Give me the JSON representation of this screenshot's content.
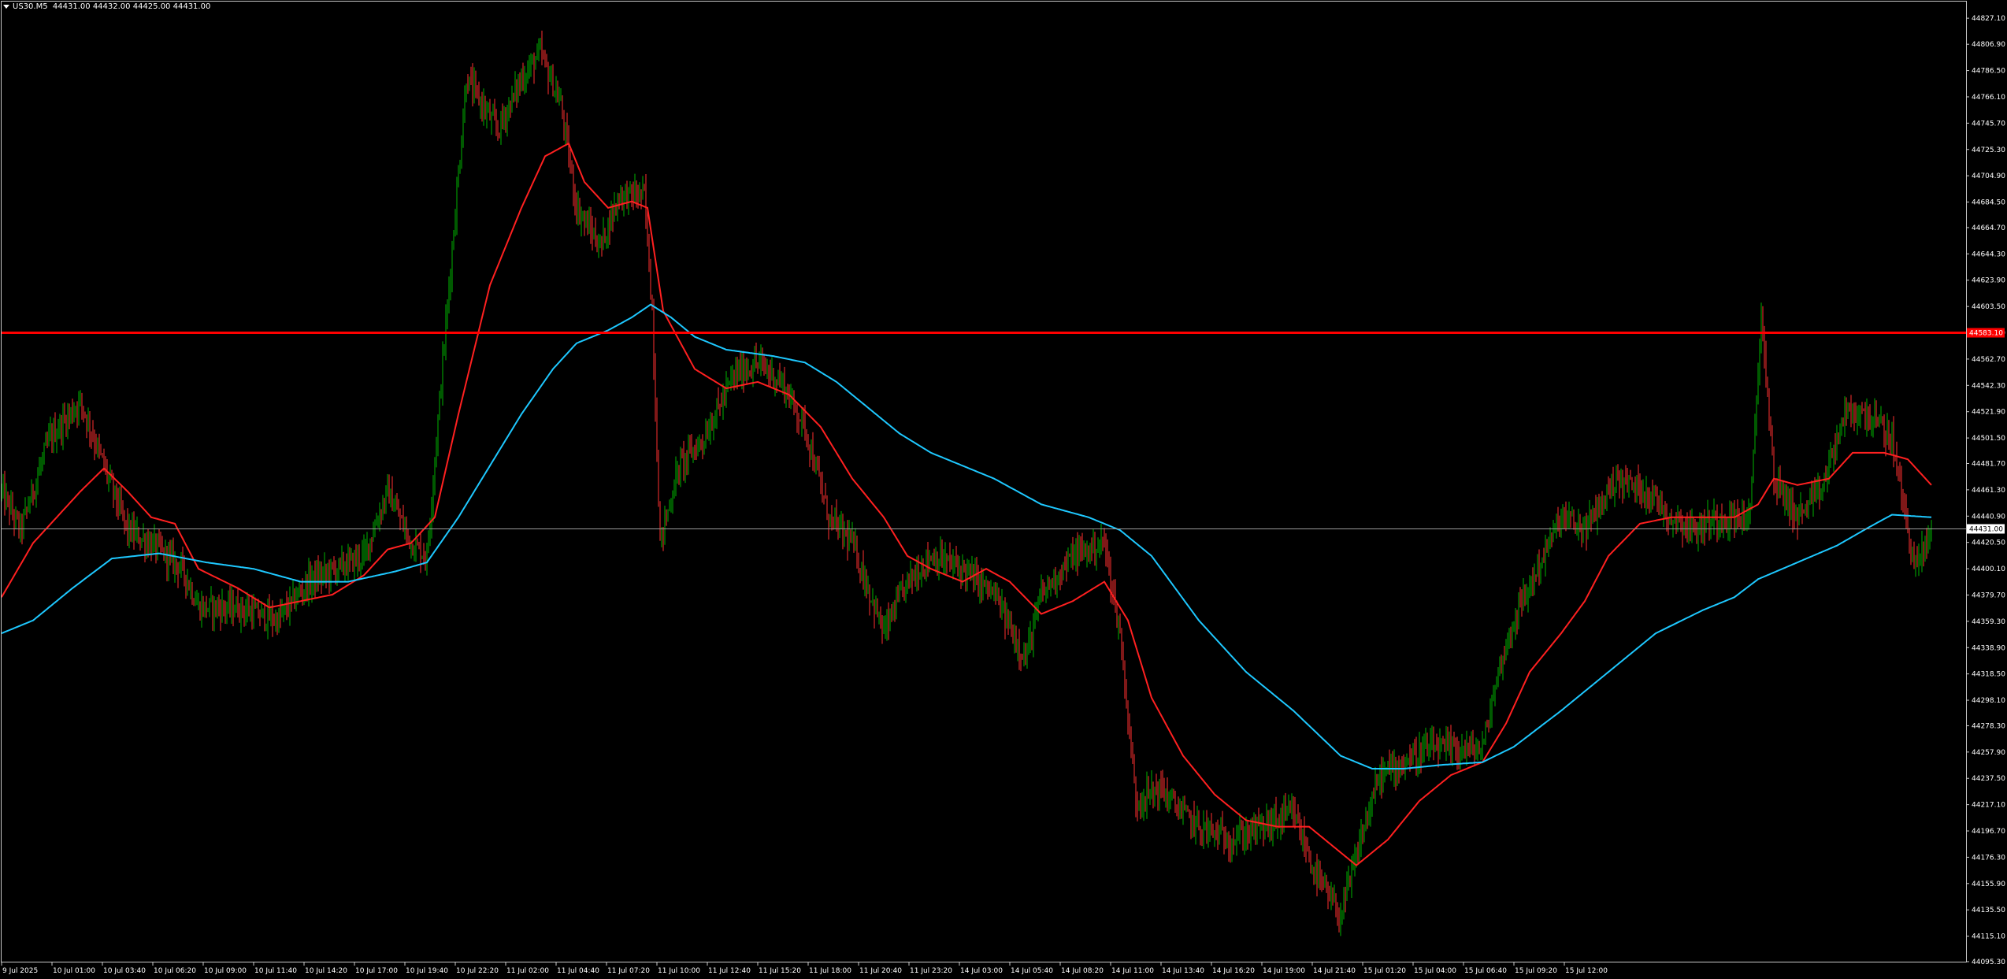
{
  "header": {
    "symbol": "US30.M5",
    "ohlc": "44431.00 44432.00 44425.00 44431.00"
  },
  "colors": {
    "background": "#000000",
    "frame": "#c8c8c8",
    "bull": "#00b400",
    "bear": "#ff3030",
    "ma_fast": "#ff2020",
    "ma_slow": "#1ec8ff",
    "hline": "#ff0000",
    "bidline": "#b4b4b4",
    "text": "#ffffff"
  },
  "price_axis": {
    "min": 44095.3,
    "max": 44840.0,
    "labels": [
      "44827.10",
      "44806.90",
      "44786.50",
      "44766.10",
      "44745.70",
      "44725.30",
      "44704.90",
      "44684.50",
      "44664.70",
      "44644.30",
      "44623.90",
      "44603.50",
      "44583.10",
      "44562.70",
      "44542.30",
      "44521.90",
      "44501.50",
      "44481.70",
      "44461.30",
      "44440.90",
      "44420.50",
      "44400.10",
      "44379.70",
      "44359.30",
      "44338.90",
      "44318.50",
      "44298.10",
      "44278.30",
      "44257.90",
      "44237.50",
      "44217.10",
      "44196.70",
      "44176.30",
      "44155.90",
      "44135.50",
      "44115.10",
      "44095.30"
    ],
    "hline_price": 44583.1,
    "hline_label": "44583.10",
    "bid_price": 44431.0,
    "bid_label": "44431.00"
  },
  "time_axis": {
    "labels": [
      "9 Jul 2025",
      "10 Jul 01:00",
      "10 Jul 03:40",
      "10 Jul 06:20",
      "10 Jul 09:00",
      "10 Jul 11:40",
      "10 Jul 14:20",
      "10 Jul 17:00",
      "10 Jul 19:40",
      "10 Jul 22:20",
      "11 Jul 02:00",
      "11 Jul 04:40",
      "11 Jul 07:20",
      "11 Jul 10:00",
      "11 Jul 12:40",
      "11 Jul 15:20",
      "11 Jul 18:00",
      "11 Jul 20:40",
      "11 Jul 23:20",
      "14 Jul 03:00",
      "14 Jul 05:40",
      "14 Jul 08:20",
      "14 Jul 11:00",
      "14 Jul 13:40",
      "14 Jul 16:20",
      "14 Jul 19:00",
      "14 Jul 21:40",
      "15 Jul 01:20",
      "15 Jul 04:00",
      "15 Jul 06:40",
      "15 Jul 09:20",
      "15 Jul 12:00"
    ]
  },
  "chart_data": {
    "type": "candlestick",
    "series": [
      {
        "name": "US30.M5",
        "role": "price",
        "keypoints": [
          [
            0,
            44460
          ],
          [
            12,
            44430
          ],
          [
            30,
            44500
          ],
          [
            50,
            44530
          ],
          [
            65,
            44480
          ],
          [
            80,
            44430
          ],
          [
            100,
            44415
          ],
          [
            115,
            44400
          ],
          [
            125,
            44370
          ],
          [
            150,
            44370
          ],
          [
            175,
            44360
          ],
          [
            195,
            44390
          ],
          [
            230,
            44410
          ],
          [
            245,
            44460
          ],
          [
            260,
            44420
          ],
          [
            270,
            44410
          ],
          [
            280,
            44560
          ],
          [
            295,
            44780
          ],
          [
            315,
            44740
          ],
          [
            330,
            44780
          ],
          [
            342,
            44800
          ],
          [
            355,
            44760
          ],
          [
            365,
            44680
          ],
          [
            380,
            44650
          ],
          [
            392,
            44690
          ],
          [
            408,
            44690
          ],
          [
            413,
            44600
          ],
          [
            418,
            44420
          ],
          [
            430,
            44480
          ],
          [
            445,
            44500
          ],
          [
            465,
            44550
          ],
          [
            480,
            44560
          ],
          [
            495,
            44545
          ],
          [
            510,
            44510
          ],
          [
            525,
            44440
          ],
          [
            540,
            44420
          ],
          [
            560,
            44350
          ],
          [
            575,
            44390
          ],
          [
            590,
            44410
          ],
          [
            610,
            44400
          ],
          [
            630,
            44380
          ],
          [
            650,
            44330
          ],
          [
            660,
            44380
          ],
          [
            680,
            44410
          ],
          [
            700,
            44420
          ],
          [
            710,
            44350
          ],
          [
            720,
            44220
          ],
          [
            735,
            44230
          ],
          [
            750,
            44210
          ],
          [
            760,
            44200
          ],
          [
            780,
            44190
          ],
          [
            800,
            44200
          ],
          [
            820,
            44210
          ],
          [
            835,
            44160
          ],
          [
            850,
            44130
          ],
          [
            865,
            44200
          ],
          [
            875,
            44240
          ],
          [
            890,
            44250
          ],
          [
            905,
            44260
          ],
          [
            920,
            44260
          ],
          [
            940,
            44260
          ],
          [
            950,
            44320
          ],
          [
            960,
            44360
          ],
          [
            975,
            44400
          ],
          [
            990,
            44440
          ],
          [
            1005,
            44430
          ],
          [
            1025,
            44470
          ],
          [
            1045,
            44460
          ],
          [
            1060,
            44440
          ],
          [
            1075,
            44430
          ],
          [
            1090,
            44440
          ],
          [
            1110,
            44440
          ],
          [
            1117,
            44600
          ],
          [
            1125,
            44470
          ],
          [
            1140,
            44440
          ],
          [
            1155,
            44460
          ],
          [
            1170,
            44520
          ],
          [
            1185,
            44520
          ],
          [
            1200,
            44500
          ],
          [
            1210,
            44430
          ],
          [
            1215,
            44400
          ],
          [
            1225,
            44430
          ]
        ]
      },
      {
        "name": "MA fast",
        "role": "ma",
        "keypoints": [
          [
            0,
            44378
          ],
          [
            20,
            44420
          ],
          [
            50,
            44460
          ],
          [
            65,
            44478
          ],
          [
            80,
            44460
          ],
          [
            95,
            44440
          ],
          [
            110,
            44435
          ],
          [
            125,
            44400
          ],
          [
            150,
            44385
          ],
          [
            170,
            44370
          ],
          [
            190,
            44375
          ],
          [
            210,
            44380
          ],
          [
            230,
            44395
          ],
          [
            245,
            44415
          ],
          [
            260,
            44420
          ],
          [
            275,
            44440
          ],
          [
            290,
            44520
          ],
          [
            310,
            44620
          ],
          [
            330,
            44680
          ],
          [
            345,
            44720
          ],
          [
            360,
            44730
          ],
          [
            370,
            44700
          ],
          [
            385,
            44680
          ],
          [
            400,
            44685
          ],
          [
            410,
            44680
          ],
          [
            420,
            44600
          ],
          [
            440,
            44555
          ],
          [
            460,
            44540
          ],
          [
            480,
            44545
          ],
          [
            500,
            44535
          ],
          [
            520,
            44510
          ],
          [
            540,
            44470
          ],
          [
            560,
            44440
          ],
          [
            575,
            44410
          ],
          [
            590,
            44400
          ],
          [
            610,
            44390
          ],
          [
            625,
            44400
          ],
          [
            640,
            44390
          ],
          [
            660,
            44365
          ],
          [
            680,
            44375
          ],
          [
            700,
            44390
          ],
          [
            715,
            44360
          ],
          [
            730,
            44300
          ],
          [
            750,
            44255
          ],
          [
            770,
            44225
          ],
          [
            790,
            44205
          ],
          [
            810,
            44200
          ],
          [
            830,
            44200
          ],
          [
            845,
            44185
          ],
          [
            860,
            44170
          ],
          [
            880,
            44190
          ],
          [
            900,
            44220
          ],
          [
            920,
            44240
          ],
          [
            940,
            44250
          ],
          [
            955,
            44280
          ],
          [
            970,
            44320
          ],
          [
            990,
            44350
          ],
          [
            1005,
            44375
          ],
          [
            1020,
            44410
          ],
          [
            1040,
            44435
          ],
          [
            1060,
            44440
          ],
          [
            1080,
            44440
          ],
          [
            1100,
            44440
          ],
          [
            1115,
            44450
          ],
          [
            1125,
            44470
          ],
          [
            1140,
            44465
          ],
          [
            1160,
            44470
          ],
          [
            1175,
            44490
          ],
          [
            1195,
            44490
          ],
          [
            1210,
            44485
          ],
          [
            1225,
            44465
          ]
        ]
      },
      {
        "name": "MA slow",
        "role": "ma",
        "keypoints": [
          [
            0,
            44350
          ],
          [
            20,
            44360
          ],
          [
            45,
            44385
          ],
          [
            70,
            44408
          ],
          [
            100,
            44412
          ],
          [
            130,
            44405
          ],
          [
            160,
            44400
          ],
          [
            190,
            44390
          ],
          [
            220,
            44390
          ],
          [
            250,
            44398
          ],
          [
            270,
            44405
          ],
          [
            290,
            44440
          ],
          [
            310,
            44480
          ],
          [
            330,
            44520
          ],
          [
            350,
            44555
          ],
          [
            365,
            44575
          ],
          [
            385,
            44585
          ],
          [
            400,
            44595
          ],
          [
            412,
            44605
          ],
          [
            425,
            44595
          ],
          [
            440,
            44580
          ],
          [
            460,
            44570
          ],
          [
            490,
            44565
          ],
          [
            510,
            44560
          ],
          [
            530,
            44545
          ],
          [
            550,
            44525
          ],
          [
            570,
            44505
          ],
          [
            590,
            44490
          ],
          [
            610,
            44480
          ],
          [
            630,
            44470
          ],
          [
            660,
            44450
          ],
          [
            690,
            44440
          ],
          [
            710,
            44430
          ],
          [
            730,
            44410
          ],
          [
            760,
            44360
          ],
          [
            790,
            44320
          ],
          [
            820,
            44290
          ],
          [
            850,
            44255
          ],
          [
            870,
            44245
          ],
          [
            890,
            44245
          ],
          [
            915,
            44248
          ],
          [
            940,
            44250
          ],
          [
            960,
            44262
          ],
          [
            990,
            44290
          ],
          [
            1020,
            44320
          ],
          [
            1050,
            44350
          ],
          [
            1080,
            44368
          ],
          [
            1100,
            44378
          ],
          [
            1115,
            44392
          ],
          [
            1140,
            44405
          ],
          [
            1165,
            44418
          ],
          [
            1185,
            44432
          ],
          [
            1200,
            44442
          ],
          [
            1225,
            44440
          ]
        ]
      }
    ],
    "ylim": [
      44095.3,
      44840.0
    ]
  }
}
